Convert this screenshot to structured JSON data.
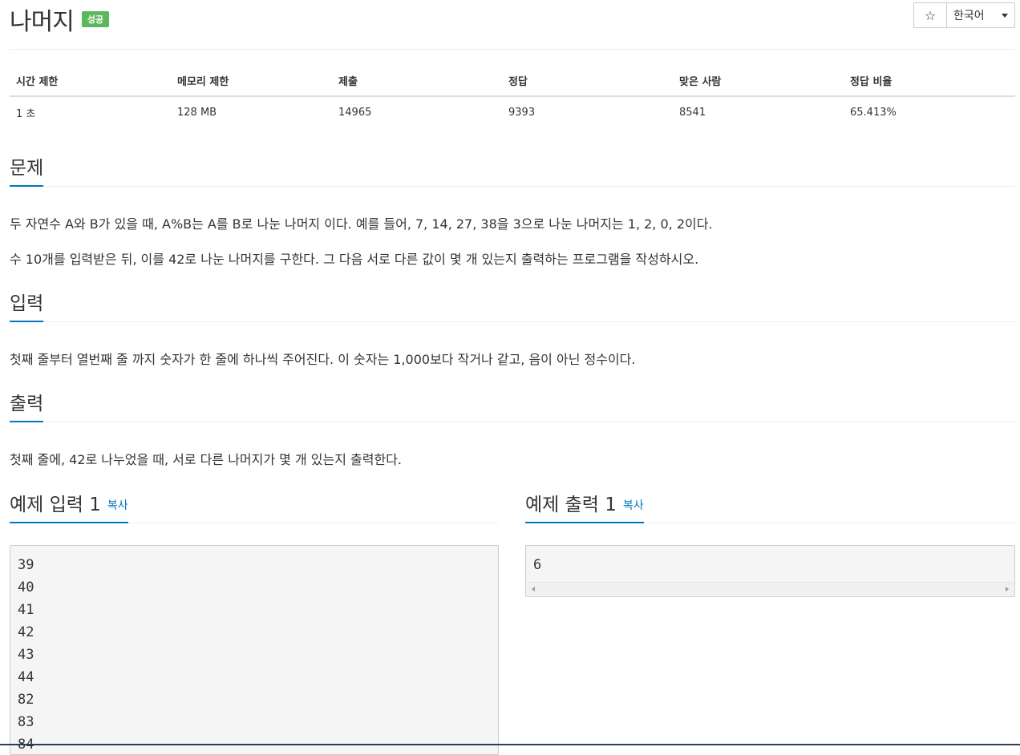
{
  "header": {
    "title": "나머지",
    "badge": "성공",
    "star": "☆",
    "language": "한국어"
  },
  "stats": {
    "headers": [
      "시간 제한",
      "메모리 제한",
      "제출",
      "정답",
      "맞은 사람",
      "정답 비율"
    ],
    "values": [
      "1 초",
      "128 MB",
      "14965",
      "9393",
      "8541",
      "65.413%"
    ]
  },
  "problem": {
    "heading": "문제",
    "p1": "두 자연수 A와 B가 있을 때, A%B는 A를 B로 나눈 나머지 이다. 예를 들어, 7, 14, 27, 38을 3으로 나눈 나머지는 1, 2, 0, 2이다.",
    "p2": "수 10개를 입력받은 뒤, 이를 42로 나눈 나머지를 구한다. 그 다음 서로 다른 값이 몇 개 있는지 출력하는 프로그램을 작성하시오."
  },
  "input": {
    "heading": "입력",
    "text": "첫째 줄부터 열번째 줄 까지 숫자가 한 줄에 하나씩 주어진다. 이 숫자는 1,000보다 작거나 같고, 음이 아닌 정수이다."
  },
  "output": {
    "heading": "출력",
    "text": "첫째 줄에, 42로 나누었을 때, 서로 다른 나머지가 몇 개 있는지 출력한다."
  },
  "sample_input": {
    "heading": "예제 입력 1",
    "copy": "복사",
    "lines": [
      "39",
      "40",
      "41",
      "42",
      "43",
      "44",
      "82",
      "83",
      "84"
    ]
  },
  "sample_output": {
    "heading": "예제 출력 1",
    "copy": "복사",
    "lines": [
      "6"
    ]
  }
}
